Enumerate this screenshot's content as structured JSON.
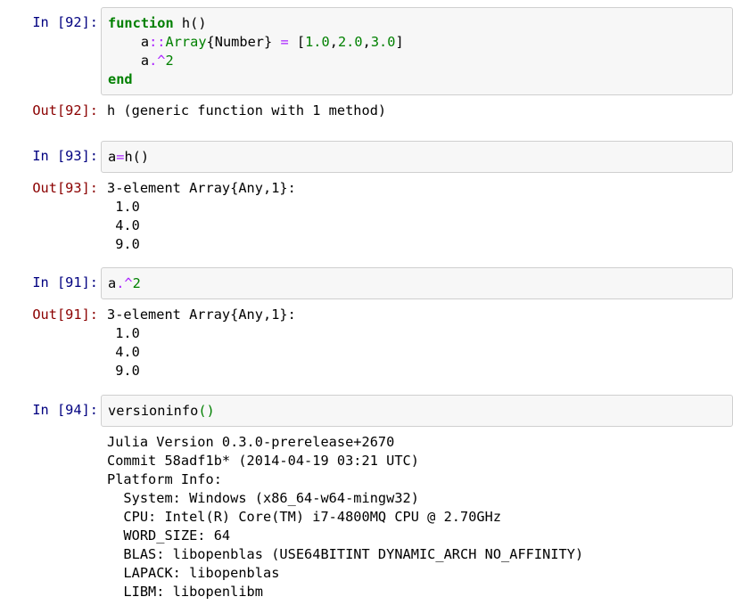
{
  "cells": [
    {
      "in_prompt": "In [92]:",
      "code": {
        "l1_kw": "function",
        "l1_rest": " h()",
        "l2_indent": "    ",
        "l2_var": "a",
        "l2_colons": "::",
        "l2_type": "Array",
        "l2_param": "{Number}",
        "l2_eq": " = ",
        "l2_lb": "[",
        "l2_n1": "1.0",
        "l2_c1": ",",
        "l2_n2": "2.0",
        "l2_c2": ",",
        "l2_n3": "3.0",
        "l2_rb": "]",
        "l3_indent": "    ",
        "l3_var": "a",
        "l3_op": ".^",
        "l3_num": "2",
        "l4_kw": "end"
      },
      "out_prompt": "Out[92]:",
      "output": [
        "h (generic function with 1 method)"
      ]
    },
    {
      "in_prompt": "In [93]:",
      "code": {
        "var": "a",
        "eq": "=",
        "call": "h()"
      },
      "out_prompt": "Out[93]:",
      "output": [
        "3-element Array{Any,1}:",
        " 1.0",
        " 4.0",
        " 9.0"
      ]
    },
    {
      "in_prompt": "In [91]:",
      "code": {
        "var": "a",
        "op": ".^",
        "num": "2"
      },
      "out_prompt": "Out[91]:",
      "output": [
        "3-element Array{Any,1}:",
        " 1.0",
        " 4.0",
        " 9.0"
      ]
    },
    {
      "in_prompt": "In [94]:",
      "code": {
        "fn": "versioninfo",
        "parens": "()"
      },
      "output": [
        "Julia Version 0.3.0-prerelease+2670",
        "Commit 58adf1b* (2014-04-19 03:21 UTC)",
        "Platform Info:",
        "  System: Windows (x86_64-w64-mingw32)",
        "  CPU: Intel(R) Core(TM) i7-4800MQ CPU @ 2.70GHz",
        "  WORD_SIZE: 64",
        "  BLAS: libopenblas (USE64BITINT DYNAMIC_ARCH NO_AFFINITY)",
        "  LAPACK: libopenblas",
        "  LIBM: libopenlibm"
      ]
    }
  ],
  "colors": {
    "input_prompt": "#000080",
    "output_prompt": "#8b0000",
    "keyword": "#008000",
    "operator": "#aa22ff",
    "cell_background": "#f7f7f7",
    "cell_border": "#cfcfcf"
  }
}
